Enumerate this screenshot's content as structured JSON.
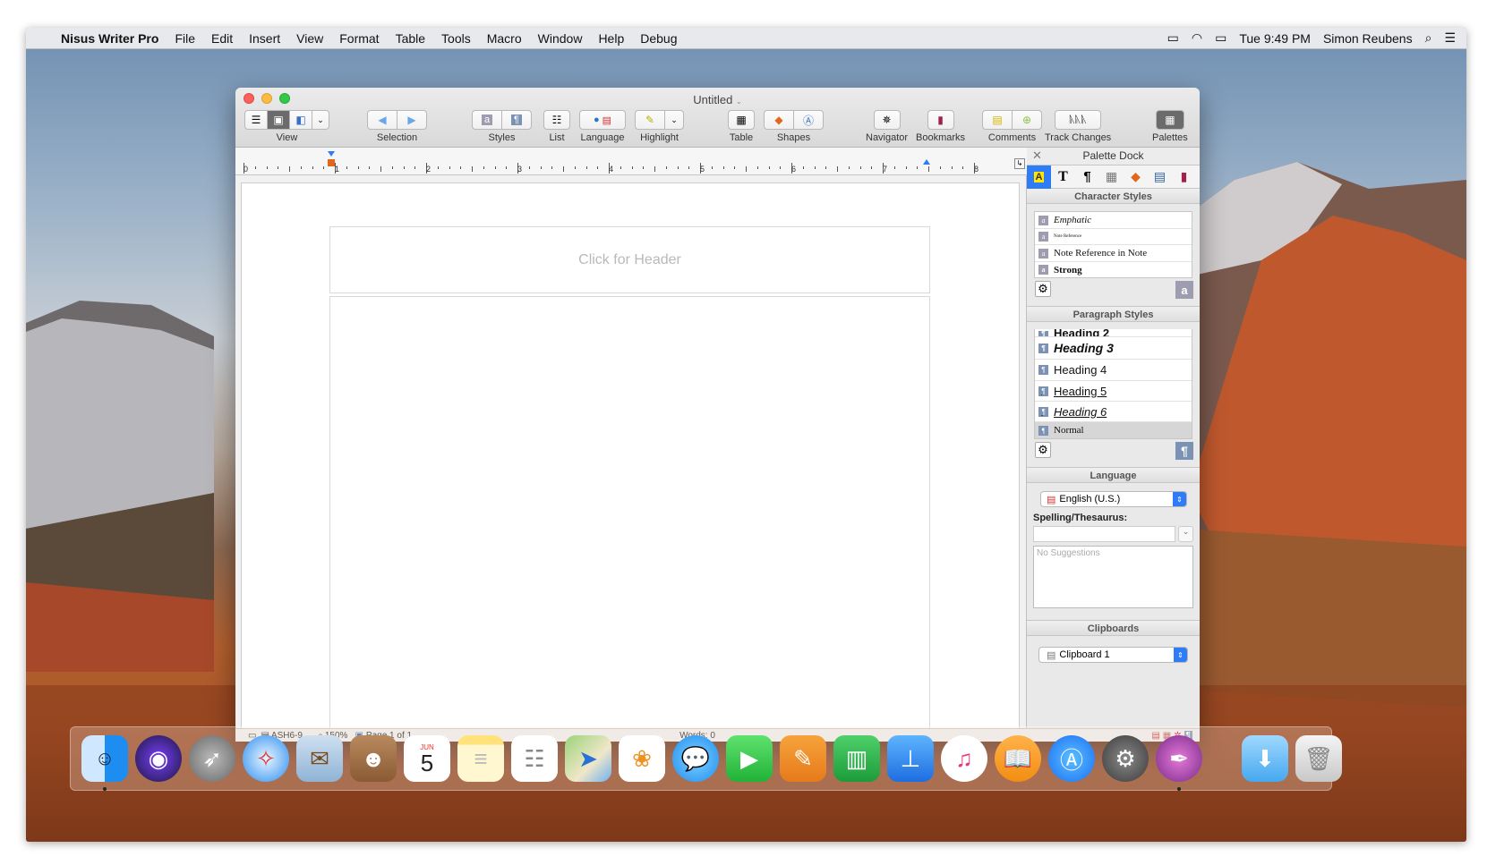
{
  "menubar": {
    "app": "Nisus Writer Pro",
    "items": [
      "File",
      "Edit",
      "Insert",
      "View",
      "Format",
      "Table",
      "Tools",
      "Macro",
      "Window",
      "Help",
      "Debug"
    ],
    "clock": "Tue 9:49 PM",
    "user": "Simon Reubens"
  },
  "window": {
    "title": "Untitled",
    "toolbar": {
      "view": "View",
      "selection": "Selection",
      "styles": "Styles",
      "list": "List",
      "language": "Language",
      "highlight": "Highlight",
      "table": "Table",
      "shapes": "Shapes",
      "navigator": "Navigator",
      "bookmarks": "Bookmarks",
      "comments": "Comments",
      "track_changes": "Track Changes",
      "palettes": "Palettes"
    },
    "ruler_numbers": [
      "0",
      "1",
      "2",
      "3",
      "4",
      "5",
      "6",
      "7",
      "8"
    ],
    "header_placeholder": "Click for Header",
    "status": {
      "style": "ASH6-9...",
      "zoom": "150%",
      "page": "Page 1 of 1",
      "words": "Words: 0"
    }
  },
  "palette": {
    "title": "Palette Dock",
    "character_styles": {
      "heading": "Character Styles",
      "items": [
        "Emphatic",
        "Note Reference",
        "Note Reference in Note",
        "Strong"
      ]
    },
    "paragraph_styles": {
      "heading": "Paragraph Styles",
      "items": [
        "Heading 2",
        "Heading 3",
        "Heading 4",
        "Heading 5",
        "Heading 6",
        "Normal"
      ]
    },
    "language": {
      "heading": "Language",
      "selected": "English (U.S.)",
      "spelling_label": "Spelling/Thesaurus:",
      "suggestions_placeholder": "No Suggestions"
    },
    "clipboards": {
      "heading": "Clipboards",
      "selected": "Clipboard 1"
    }
  },
  "dock": {
    "apps": [
      "Finder",
      "Siri",
      "Launchpad",
      "Safari",
      "Mail",
      "Contacts",
      "Calendar",
      "Notes",
      "Reminders",
      "Maps",
      "Photos",
      "Messages",
      "FaceTime",
      "Pages",
      "Numbers",
      "Keynote",
      "iTunes",
      "iBooks",
      "App Store",
      "System Preferences",
      "Nisus Writer Pro",
      "Downloads",
      "Trash"
    ],
    "calendar_month": "JUN",
    "calendar_day": "5"
  },
  "colors": {
    "accent": "#2e7df6",
    "close": "#fc605c",
    "minimize": "#fdbc40",
    "zoom": "#34c84a"
  }
}
